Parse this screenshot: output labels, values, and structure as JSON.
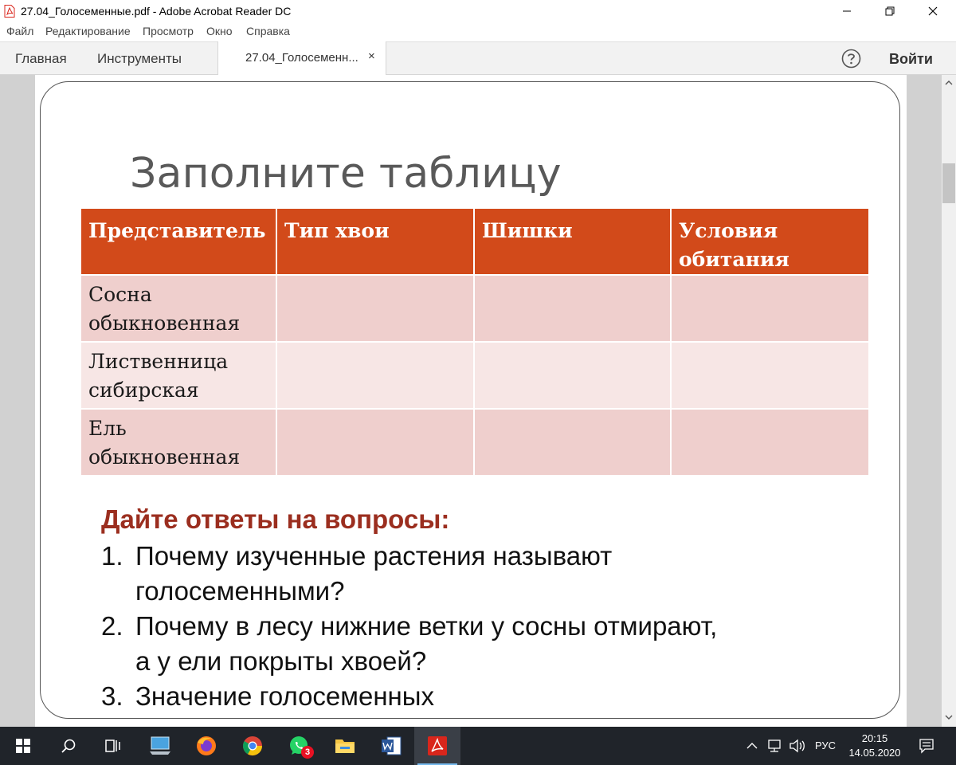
{
  "window": {
    "title": "27.04_Голосеменные.pdf - Adobe Acrobat Reader DC"
  },
  "menu": {
    "items": [
      "Файл",
      "Редактирование",
      "Просмотр",
      "Окно",
      "Справка"
    ]
  },
  "tabs": {
    "home": "Главная",
    "tools": "Инструменты",
    "document_tab": "27.04_Голосеменн...",
    "close_glyph": "×",
    "sign_in": "Войти"
  },
  "slide": {
    "title": "Заполните таблицу",
    "table": {
      "headers": [
        "Представитель",
        "Тип хвои",
        "Шишки",
        "Условия обитания"
      ],
      "rows": [
        [
          "Сосна обыкновенная",
          "",
          "",
          ""
        ],
        [
          "Лиственница сибирская",
          "",
          "",
          ""
        ],
        [
          "Ель обыкновенная",
          "",
          "",
          ""
        ]
      ]
    },
    "questions_heading": "Дайте ответы на вопросы:",
    "questions": [
      {
        "num": "1.",
        "lines": [
          "Почему изученные растения называют",
          "голосеменными?"
        ]
      },
      {
        "num": "2.",
        "lines": [
          "Почему в лесу нижние ветки у сосны отмирают,",
          "а у ели покрыты хвоей?"
        ]
      },
      {
        "num": "3.",
        "lines": [
          "Значение голосеменных"
        ]
      }
    ]
  },
  "taskbar": {
    "whatsapp_badge": "3",
    "language": "РУС",
    "time": "20:15",
    "date": "14.05.2020"
  },
  "colors": {
    "table_header": "#d24a1a",
    "row_odd": "#efcfcd",
    "row_even": "#f7e6e5",
    "questions_heading": "#9b2e1f",
    "taskbar": "#20242a"
  }
}
